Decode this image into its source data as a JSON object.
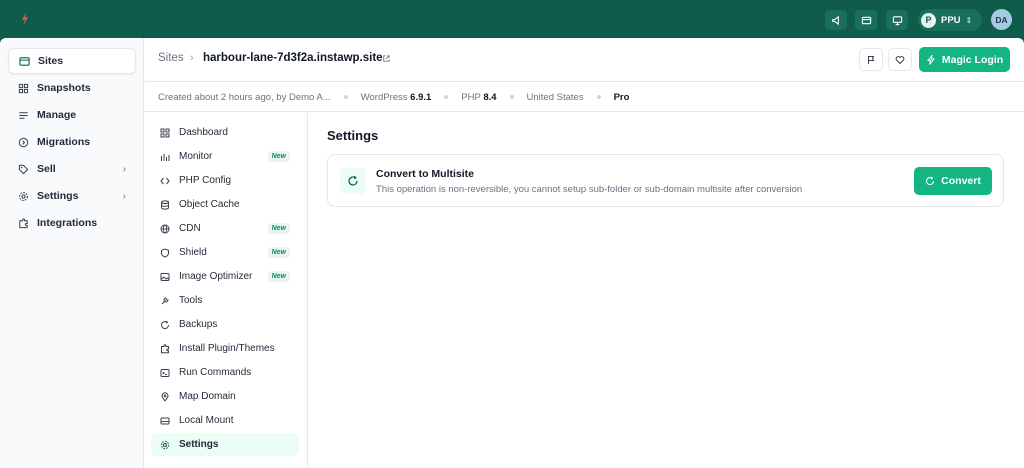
{
  "topbar": {
    "team_initial": "P",
    "team_name": "PPU",
    "avatar_initials": "DA"
  },
  "sidebar": {
    "items": [
      {
        "label": "Sites",
        "icon": "browser-icon"
      },
      {
        "label": "Snapshots",
        "icon": "grid-icon"
      },
      {
        "label": "Manage",
        "icon": "list-icon"
      },
      {
        "label": "Migrations",
        "icon": "migrate-icon"
      },
      {
        "label": "Sell",
        "icon": "tag-icon",
        "arrow": "›"
      },
      {
        "label": "Settings",
        "icon": "gear-icon",
        "arrow": "›"
      },
      {
        "label": "Integrations",
        "icon": "puzzle-icon"
      }
    ]
  },
  "header": {
    "crumb_root": "Sites",
    "crumb_sep": "›",
    "site_name": "harbour-lane-7d3f2a.instawp.site",
    "magic_login_label": "Magic Login"
  },
  "meta": {
    "created": "Created about 2 hours ago, by Demo A...",
    "wordpress_label": "WordPress",
    "wordpress_version": "6.9.1",
    "php_label": "PHP",
    "php_version": "8.4",
    "region": "United States",
    "plan": "Pro"
  },
  "subnav": {
    "items": [
      {
        "label": "Dashboard",
        "icon": "grid-icon"
      },
      {
        "label": "Monitor",
        "icon": "bar-chart-icon",
        "badge": "New"
      },
      {
        "label": "PHP Config",
        "icon": "code-icon"
      },
      {
        "label": "Object Cache",
        "icon": "database-icon"
      },
      {
        "label": "CDN",
        "icon": "globe-icon",
        "badge": "New"
      },
      {
        "label": "Shield",
        "icon": "shield-icon",
        "badge": "New"
      },
      {
        "label": "Image Optimizer",
        "icon": "image-icon",
        "badge": "New"
      },
      {
        "label": "Tools",
        "icon": "wrench-icon"
      },
      {
        "label": "Backups",
        "icon": "refresh-icon"
      },
      {
        "label": "Install Plugin/Themes",
        "icon": "puzzle-icon"
      },
      {
        "label": "Run Commands",
        "icon": "terminal-icon"
      },
      {
        "label": "Map Domain",
        "icon": "pin-icon"
      },
      {
        "label": "Local Mount",
        "icon": "drive-icon"
      },
      {
        "label": "Settings",
        "icon": "gear-icon"
      }
    ]
  },
  "content": {
    "title": "Settings",
    "card_title": "Convert to Multisite",
    "card_desc": "This operation is non-reversible, you cannot setup sub-folder or sub-domain multisite after conversion",
    "convert_label": "Convert"
  },
  "colors": {
    "brand": "#0f5c4b",
    "accent": "#13b582",
    "logo": "#e8553b"
  }
}
